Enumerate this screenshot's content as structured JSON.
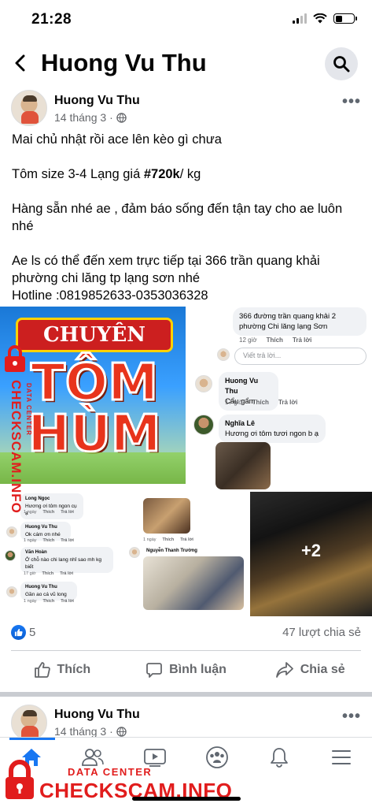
{
  "status_bar": {
    "time": "21:28"
  },
  "header": {
    "title": "Huong Vu Thu"
  },
  "post": {
    "author": "Huong Vu Thu",
    "date": "14 tháng 3",
    "dot": "·",
    "text_lines": {
      "l1": "Mai chủ nhật rồi ace lên kèo gì chưa",
      "l2_pre": "Tôm size 3-4 Lạng giá ",
      "l2_tag": "#720k",
      "l2_post": "/ kg",
      "l3": " Hàng sẵn nhé ae , đảm báo sống đến tận tay cho ae luôn nhé",
      "l4": "Ae ls có thể đến xem trực tiếp tại 366 trần quang khải phường chi lăng tp lạng sơn nhé",
      "l5": "Hotline :0819852633-0353036328"
    },
    "banner": {
      "top": "CHUYÊN",
      "line1": "TÔM",
      "line2": "HÙM"
    },
    "comments_panel": {
      "c1_text": "366 đường trần quang khải 2 phường Chi lăng lạng Sơn",
      "c1_time": "12 giờ",
      "like": "Thích",
      "reply": "Trả lời",
      "reply_placeholder": "Viết trả lời...",
      "c2_name": "Huong Vu Thu",
      "c2_text": "Cẩu gẩm",
      "c2_time": "17 giờ",
      "c3_name": "Nghĩa Lê",
      "c3_text": "Hương ơi tôm tươi ngon b ạ"
    },
    "comments_panel2": {
      "c1_name": "Long Ngọc",
      "c1_text": "Hương ơi tôm ngon cụ ạ",
      "c1_time": "1 ngày",
      "c2_name": "Huong Vu Thu",
      "c2_text": "Ok cám ơn nhé",
      "c2_time": "1 ngày",
      "c3_name": "Văn Hoàn",
      "c3_text": "Ở chỗ nào chi lang nhỉ sao mh kg biết",
      "c3_time": "17 giờ",
      "c4_name": "Huong Vu Thu",
      "c4_text": "Gần ao cá vũ long",
      "c4_time": "1 ngày",
      "like": "Thích",
      "reply": "Trả lời"
    },
    "photo_panel": {
      "time": "1 ngày",
      "like": "Thích",
      "reply": "Trả lời",
      "name": "Nguyễn Thanh Trường"
    },
    "more_photos": "+2",
    "likes": "5",
    "shares": "47 lượt chia sẻ",
    "actions": {
      "like": "Thích",
      "comment": "Bình luận",
      "share": "Chia sẻ"
    }
  },
  "post2": {
    "author": "Huong Vu Thu",
    "date": "14 tháng 3",
    "dot": "·"
  },
  "watermark": {
    "vertical_main": "CHECKSCAM.INFO",
    "vertical_sub": "DATA CENTER",
    "bottom_top": "DATA CENTER",
    "bottom_main": "CHECKSCAM.INFO"
  },
  "icons": [
    "back-arrow-icon",
    "search-icon",
    "globe-icon",
    "more-icon",
    "like-icon",
    "comment-icon",
    "share-icon",
    "home-icon",
    "friends-icon",
    "video-icon",
    "groups-icon",
    "bell-icon",
    "menu-icon",
    "lock-icon"
  ],
  "colors": {
    "brand_blue": "#1877f2",
    "watermark_red": "#e11d1d",
    "meta_gray": "#65676b"
  }
}
